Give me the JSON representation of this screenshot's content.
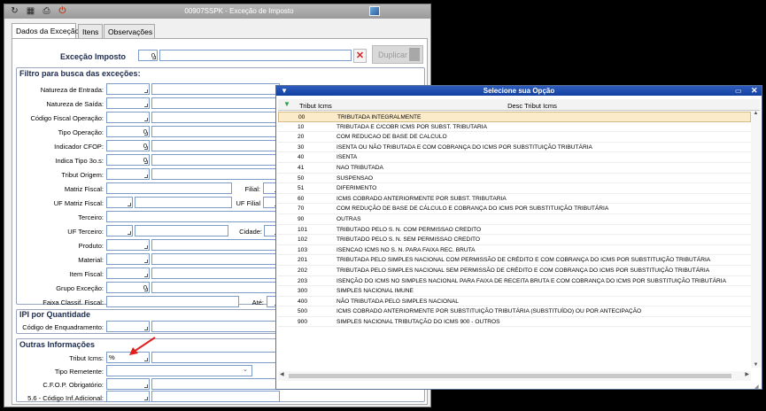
{
  "window": {
    "title": "00907SSPK - Exceção de Imposto",
    "tabs": [
      "Dados da Exceção",
      "Itens",
      "Observações"
    ]
  },
  "header": {
    "excecao_label": "Exceção Imposto",
    "excecao_value": "0",
    "duplicar_label": "Duplicar"
  },
  "filtro": {
    "title": "Filtro para busca das exceções:",
    "natureza_entrada": "Natureza de Entrada:",
    "natureza_saida": "Natureza de Saída:",
    "cfop_operacao": "Código Fiscal Operação:",
    "tipo_operacao": "Tipo Operação:",
    "tipo_operacao_value": "0",
    "indicador_cfop": "Indicador CFOP:",
    "indicador_cfop_value": "0",
    "indica_tipo": "Indica Tipo 3o.s:",
    "indica_tipo_value": "0",
    "tribut_origem": "Tribut Origem:",
    "matriz_fiscal": "Matriz Fiscal:",
    "filial": "Filial:",
    "uf_matriz": "UF Matriz Fiscal:",
    "uf_filial": "UF Filial",
    "terceiro": "Terceiro:",
    "uf_terceiro": "UF Terceiro:",
    "cidade": "Cidade:",
    "produto": "Produto:",
    "material": "Material:",
    "item_fiscal": "Item Fiscal:",
    "grupo_excecao": "Grupo Exceção:",
    "grupo_excecao_value": "0",
    "faixa_classif": "Faixa Classif. Fiscal:",
    "ate": "Até:"
  },
  "ipi": {
    "title": "IPI por Quantidade",
    "codigo_enquadramento": "Código de Enquadramento:"
  },
  "outras": {
    "title": "Outras Informações",
    "tribut_icms": "Tribut Icms:",
    "tribut_icms_value": "%",
    "tipo_remetente": "Tipo Remetente:",
    "cfop_obrigatorio": "C.F.O.P. Obrigatório:",
    "codigo_inf_adicional": "5.6 - Código Inf.Adicional:"
  },
  "popup": {
    "title": "Selecione sua Opção",
    "columns": [
      "Tribut Icms",
      "Desc Tribut Icms"
    ],
    "rows": [
      [
        "00",
        "TRIBUTADA INTEGRALMENTE"
      ],
      [
        "10",
        "TRIBUTADA E C/COBR ICMS POR SUBST. TRIBUTARIA"
      ],
      [
        "20",
        "COM REDUCAO DE BASE DE CALCULO"
      ],
      [
        "30",
        "ISENTA OU NÃO TRIBUTADA E COM COBRANÇA DO ICMS POR SUBSTITUIÇÃO TRIBUTÁRIA"
      ],
      [
        "40",
        "ISENTA"
      ],
      [
        "41",
        "NAO TRIBUTADA"
      ],
      [
        "50",
        "SUSPENSAO"
      ],
      [
        "51",
        "DIFERIMENTO"
      ],
      [
        "60",
        "ICMS COBRADO ANTERIORMENTE POR SUBST. TRIBUTARIA"
      ],
      [
        "70",
        "COM REDUÇÃO DE BASE DE CÁLCULO E COBRANÇA DO ICMS POR SUBSTITUIÇÃO TRIBUTÁRIA"
      ],
      [
        "90",
        "OUTRAS"
      ],
      [
        "101",
        "TRIBUTADO PELO S. N. COM PERMISSAO CREDITO"
      ],
      [
        "102",
        "TRIBUTADO PELO S. N. SEM PERMISSAO CREDITO"
      ],
      [
        "103",
        "ISENCAO ICMS NO S. N. PARA FAIXA REC. BRUTA"
      ],
      [
        "201",
        "TRIBUTADA PELO SIMPLES NACIONAL COM PERMISSÃO DE CRÉDITO E COM COBRANÇA DO ICMS POR SUBSTITUIÇÃO TRIBUTÁRIA"
      ],
      [
        "202",
        "TRIBUTADA PELO SIMPLES NACIONAL SEM PERMISSÃO DE CRÉDITO E COM COBRANÇA DO ICMS POR SUBSTITUIÇÃO TRIBUTÁRIA"
      ],
      [
        "203",
        "ISENÇÃO DO ICMS NO SIMPLES NACIONAL PARA FAIXA DE RECEITA BRUTA E COM COBRANÇA DO ICMS POR SUBSTITUIÇÃO TRIBUTÁRIA"
      ],
      [
        "300",
        "SIMPLES NACIONAL IMUNE"
      ],
      [
        "400",
        "NÃO TRIBUTADA PELO SIMPLES NACIONAL"
      ],
      [
        "500",
        "ICMS COBRADO ANTERIORMENTE POR SUBSTITUIÇÃO TRIBUTÁRIA (SUBSTITUÍDO) OU POR ANTECIPAÇÃO"
      ],
      [
        "900",
        "SIMPLES NACIONAL TRIBUTAÇÃO DO ICMS 900 - OUTROS"
      ]
    ],
    "selected_index": 0
  },
  "colors": {
    "popup_title_bg": "#1340a0",
    "selected_row": "#fcebc9",
    "annotation_arrow": "#e02020",
    "label_text": "#1c2b4e"
  }
}
